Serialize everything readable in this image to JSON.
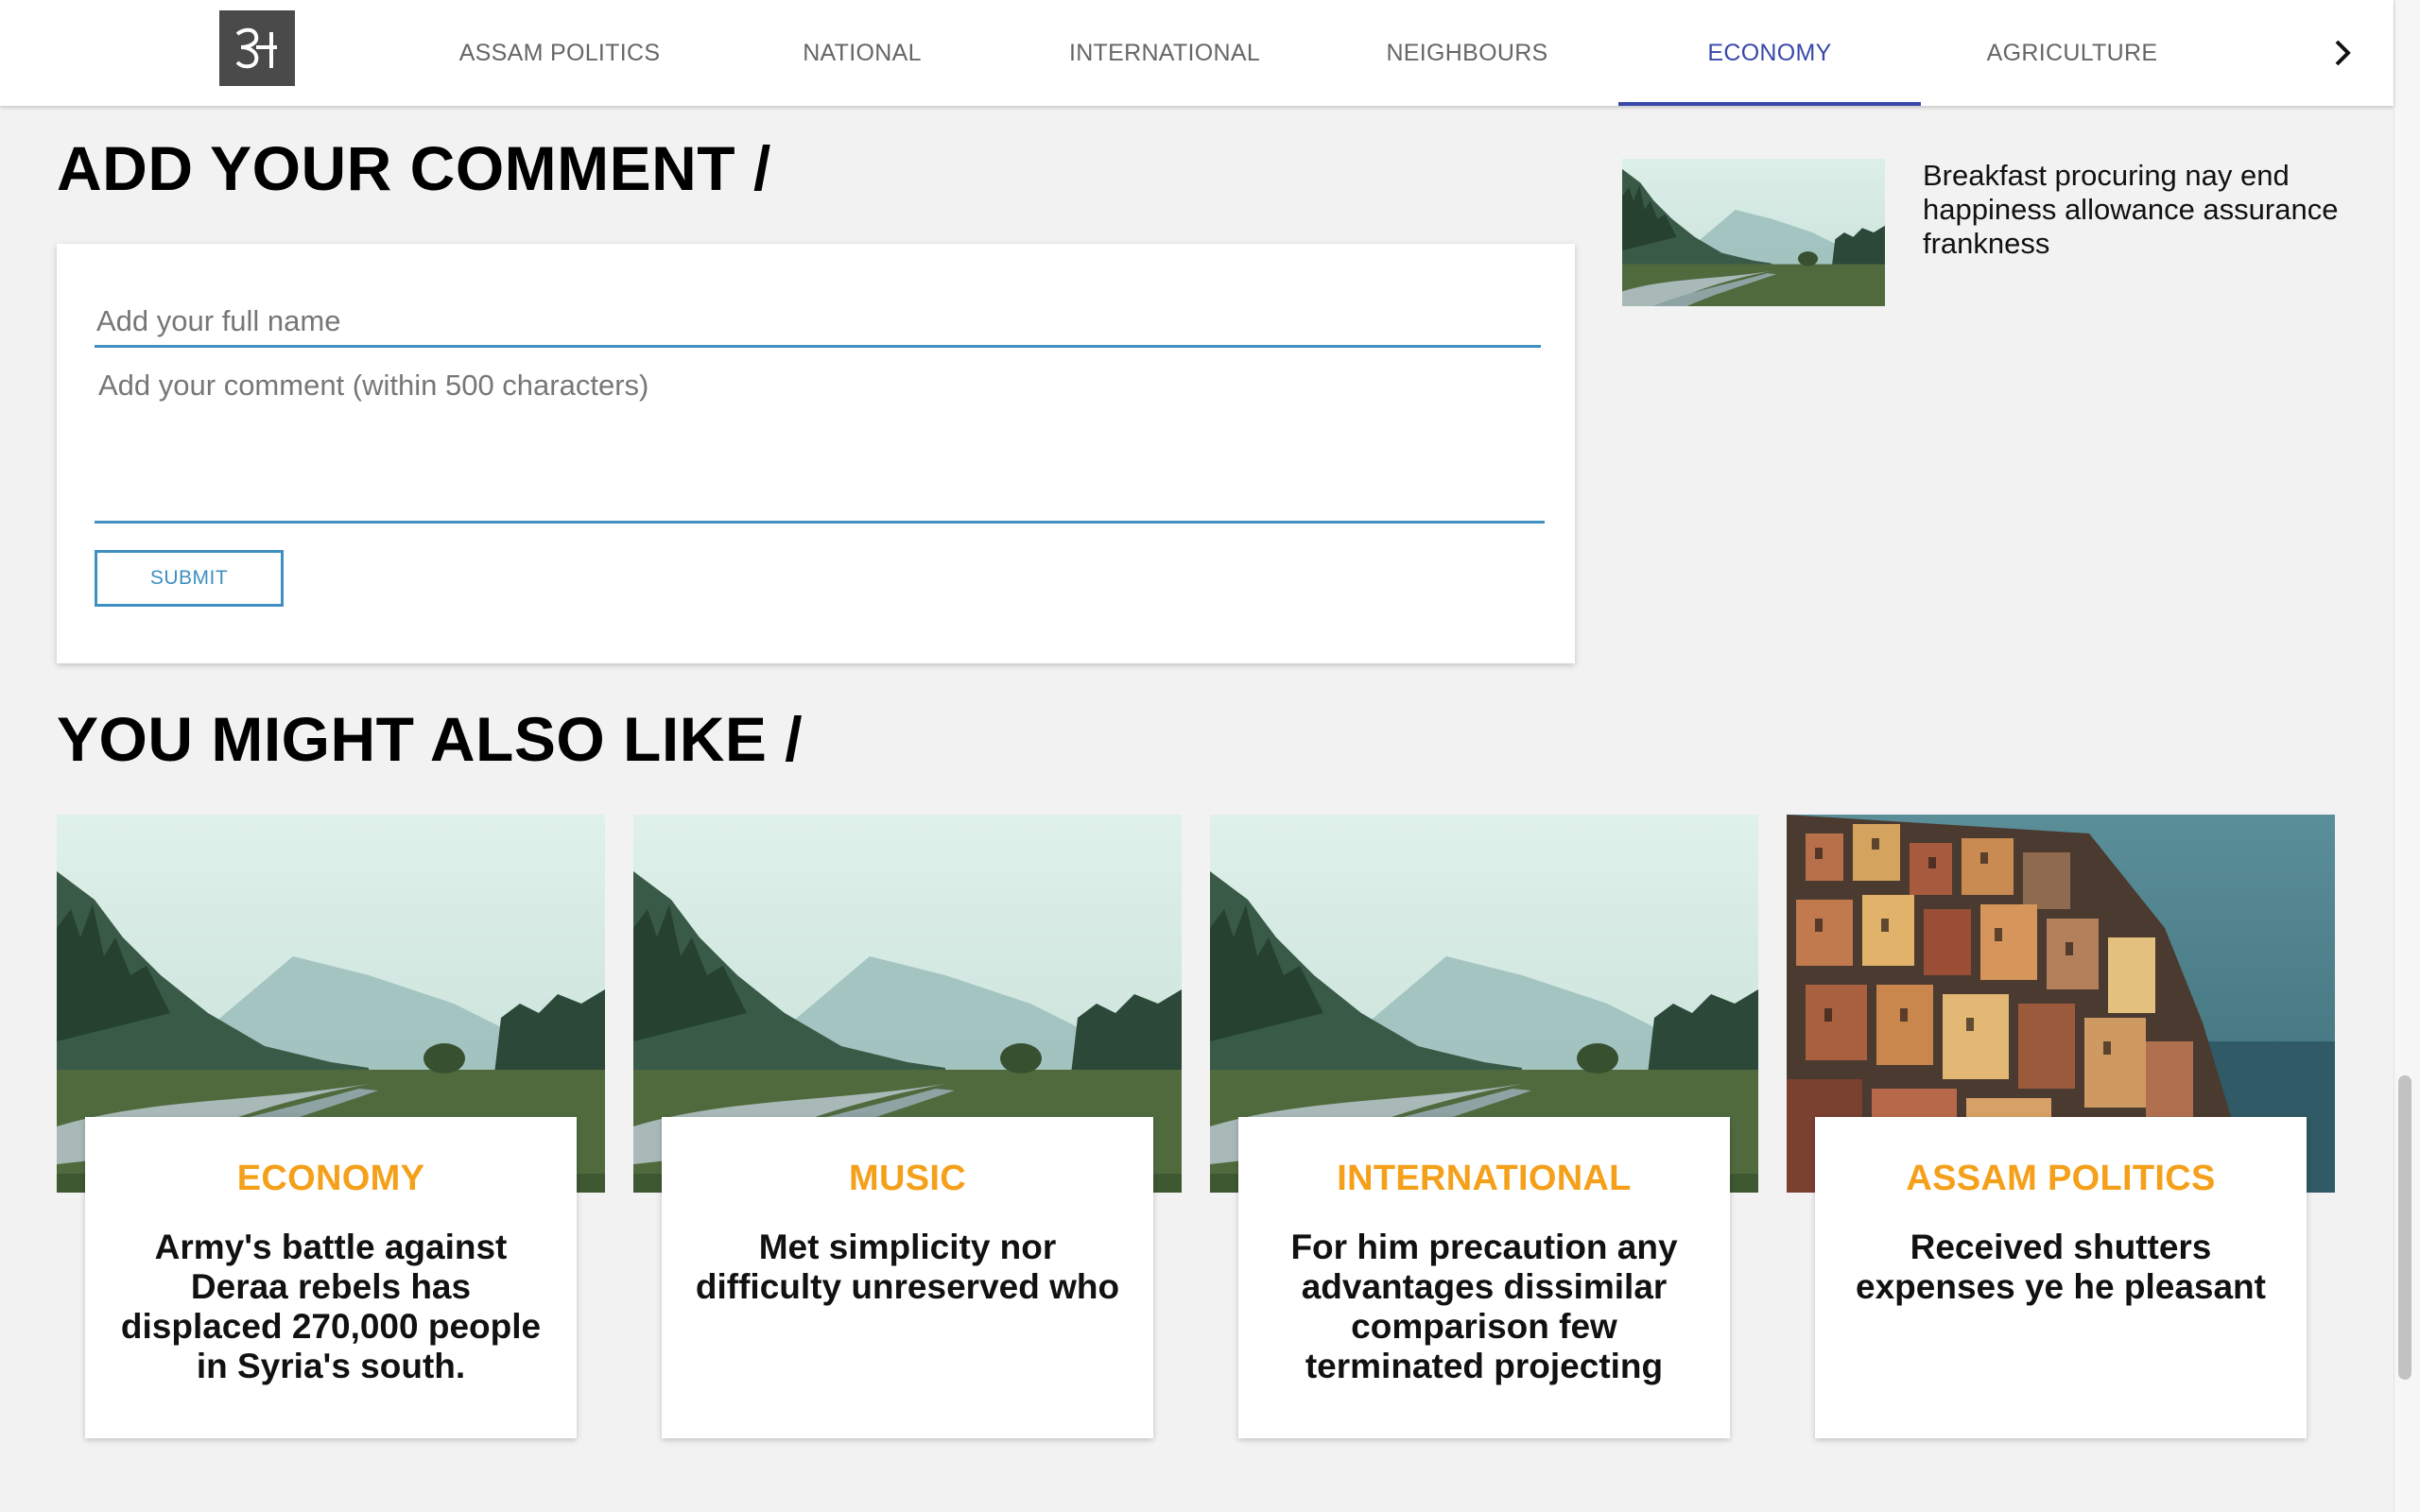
{
  "nav": {
    "logo_glyph": "অ",
    "items": [
      {
        "label": "ASSAM POLITICS",
        "active": false
      },
      {
        "label": "NATIONAL",
        "active": false
      },
      {
        "label": "INTERNATIONAL",
        "active": false
      },
      {
        "label": "NEIGHBOURS",
        "active": false
      },
      {
        "label": "ECONOMY",
        "active": true
      },
      {
        "label": "AGRICULTURE",
        "active": false
      }
    ],
    "next_icon": "chevron-right-icon",
    "active_color": "#3848a8"
  },
  "comment": {
    "heading": "ADD YOUR COMMENT /",
    "name_placeholder": "Add your full name",
    "comment_placeholder": "Add your comment (within 500 characters)",
    "submit_label": "SUBMIT"
  },
  "side_story": {
    "title": "Breakfast procuring nay end happiness allowance assurance frankness",
    "image": "landscape"
  },
  "related": {
    "heading": "YOU MIGHT ALSO LIKE /",
    "category_color": "#f5a01a",
    "cards": [
      {
        "category": "ECONOMY",
        "title": "Army's battle against Deraa rebels has displaced 270,000 people in Syria's south.",
        "image": "landscape"
      },
      {
        "category": "MUSIC",
        "title": "Met simplicity nor difficulty unreserved who",
        "image": "landscape"
      },
      {
        "category": "INTERNATIONAL",
        "title": "For him precaution any advantages dissimilar comparison few terminated projecting",
        "image": "landscape"
      },
      {
        "category": "ASSAM POLITICS",
        "title": "Received shutters expenses ye he pleasant",
        "image": "cliff-town"
      }
    ]
  }
}
